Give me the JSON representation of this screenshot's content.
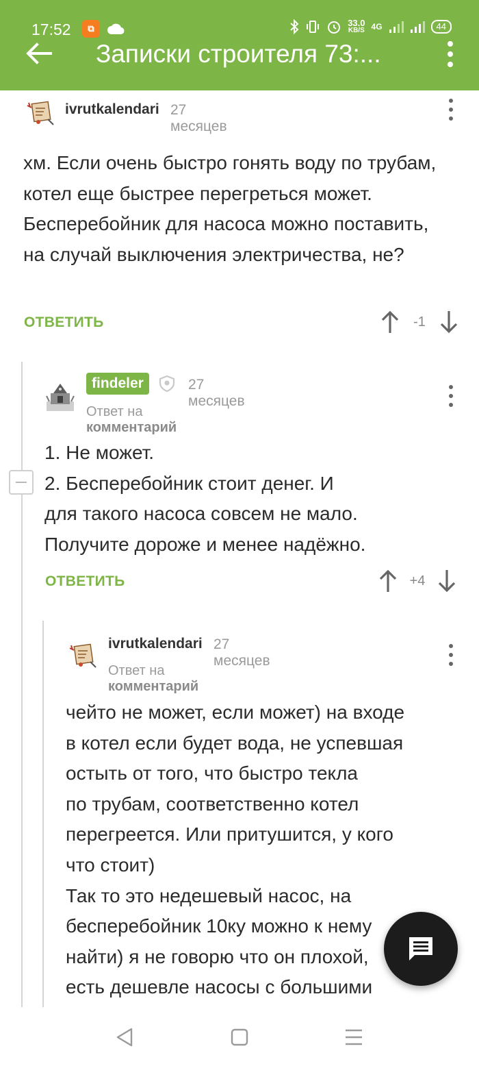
{
  "status_bar": {
    "time": "17:52",
    "speed_value": "33.0",
    "speed_unit": "KB/S",
    "network": "4G",
    "battery": "44",
    "icons": [
      "mi-icon",
      "cloud-icon",
      "bluetooth-icon",
      "vibrate-icon",
      "alarm-icon",
      "signal-icon",
      "signal-icon",
      "battery-icon"
    ]
  },
  "app_bar": {
    "title": "Записки строителя 73:...",
    "back_icon": "arrow-left-icon",
    "menu_icon": "more-vert-icon"
  },
  "colors": {
    "accent": "#7db546",
    "text": "#2b2b2b",
    "muted": "#9a9a9a",
    "fab": "#1c1c1c"
  },
  "comments": [
    {
      "author": "ivrutkalendari",
      "time": "27 месяцев",
      "text": "хм. Если очень быстро гонять воду по трубам, котел еще быстрее перегреться может. Бесперебойник для насоса можно поставить, на случай выключения электричества, не?",
      "reply_label": "ОТВЕТИТЬ",
      "rating": "-1"
    },
    {
      "author": "findeler",
      "author_badge": "shield-icon",
      "time": "27 месяцев",
      "reply_to_prefix": "Ответ на",
      "reply_to_target": "комментарий",
      "lines": [
        "1. Не может.",
        "2. Бесперебойник стоит денег. И",
        "для такого насоса совсем не мало.",
        "Получите дороже и менее надёжно."
      ],
      "reply_label": "ОТВЕТИТЬ",
      "rating": "+4"
    },
    {
      "author": "ivrutkalendari",
      "time": "27 месяцев",
      "reply_to_prefix": "Ответ на",
      "reply_to_target": "комментарий",
      "lines": [
        "чейто не может, если может) на входе",
        "в котел если будет вода, не успевшая",
        "остыть от того, что быстро текла",
        "по трубам, соответственно котел",
        "перегреется. Или притушится, у кого",
        "что стоит)",
        "Так то это недешевый насос, на",
        "бесперебойник 10ку можно к нему",
        "найти) я не говорю что он плохой,",
        "есть дешевле насосы с большими"
      ]
    }
  ],
  "fab": {
    "icon": "chat-icon"
  },
  "nav_bar": {
    "icons": [
      "back-triangle-icon",
      "home-square-icon",
      "recents-menu-icon"
    ]
  }
}
